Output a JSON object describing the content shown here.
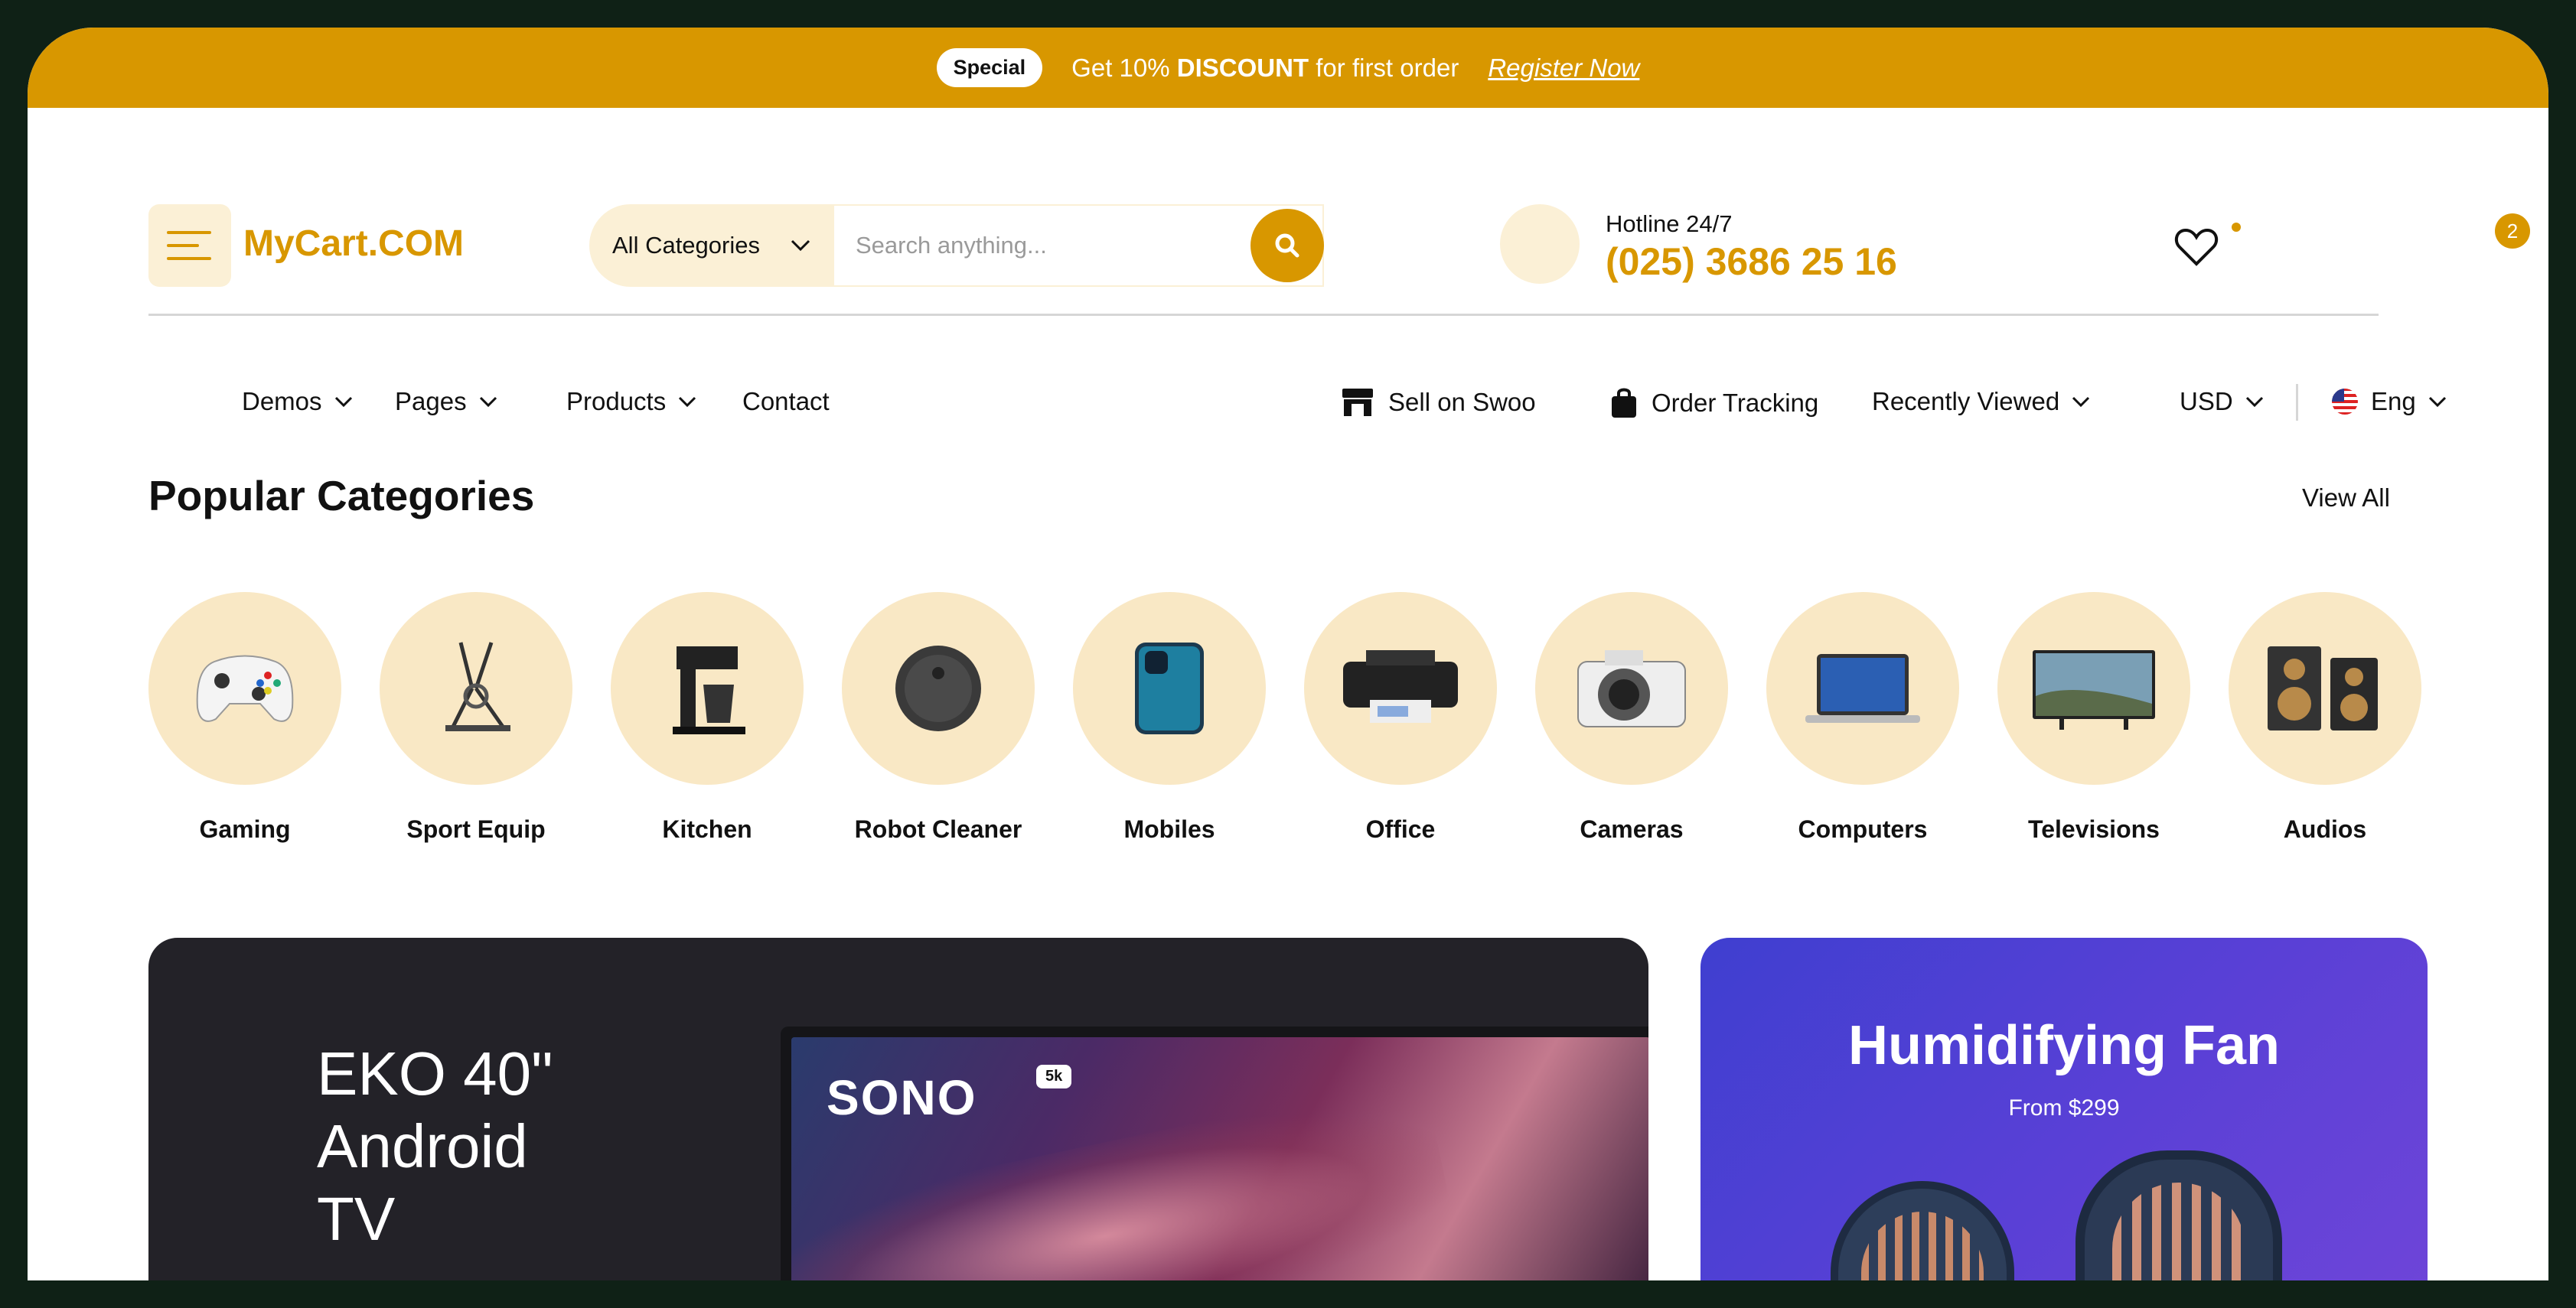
{
  "promo": {
    "badge": "Special",
    "text_before": "Get 10% ",
    "text_bold": "DISCOUNT",
    "text_after": " for first order",
    "link": "Register Now"
  },
  "header": {
    "logo": "MyCart.COM",
    "category_select": "All Categories",
    "search_placeholder": "Search anything...",
    "hotline_label": "Hotline 24/7",
    "hotline_number": "(025) 3686 25 16",
    "cart_count": "2"
  },
  "nav": {
    "left": [
      "Demos",
      "Pages",
      "Products",
      "Contact"
    ],
    "sell": "Sell on Swoo",
    "order_tracking": "Order Tracking",
    "recently_viewed": "Recently Viewed",
    "currency": "USD",
    "language": "Eng"
  },
  "categories": {
    "title": "Popular Categories",
    "view_all": "View All",
    "items": [
      "Gaming",
      "Sport Equip",
      "Kitchen",
      "Robot Cleaner",
      "Mobiles",
      "Office",
      "Cameras",
      "Computers",
      "Televisions",
      "Audios"
    ]
  },
  "banners": {
    "tv": {
      "title": "EKO 40\"\nAndroid\nTV",
      "brand": "SONO",
      "badge": "5k"
    },
    "fan": {
      "title": "Humidifying Fan",
      "subtitle": "From $299"
    }
  },
  "colors": {
    "accent": "#d89700",
    "accent_light": "#f9e8c5",
    "dark": "#232228",
    "fan_bg": "#5a40d6"
  }
}
